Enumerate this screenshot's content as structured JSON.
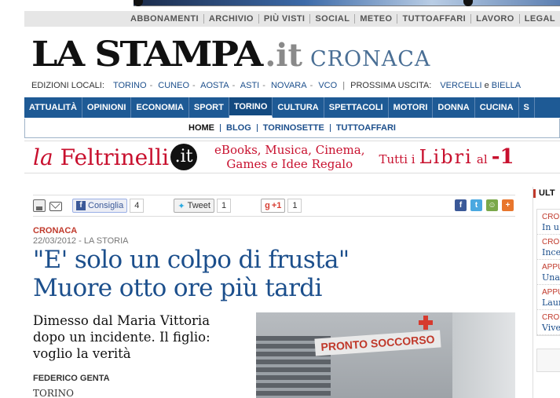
{
  "utility_nav": [
    "ABBONAMENTI",
    "ARCHIVIO",
    "PIÙ VISTI",
    "SOCIAL",
    "METEO",
    "TUTTOAFFARI",
    "LAVORO",
    "LEGAL"
  ],
  "masthead": {
    "logo": "LA STAMPA",
    "logo_suffix": ".it",
    "section": "CRONACA"
  },
  "editions": {
    "label": "EDIZIONI LOCALI:",
    "items": [
      "TORINO",
      "CUNEO",
      "AOSTA",
      "ASTI",
      "NOVARA",
      "VCO"
    ],
    "next_label": "PROSSIMA USCITA:",
    "next_items": [
      "VERCELLI",
      "BIELLA"
    ],
    "conj": "e"
  },
  "main_nav": [
    "ATTUALITÀ",
    "OPINIONI",
    "ECONOMIA",
    "SPORT",
    "TORINO",
    "CULTURA",
    "SPETTACOLI",
    "MOTORI",
    "DONNA",
    "CUCINA",
    "S"
  ],
  "main_nav_active": "TORINO",
  "sub_nav": [
    "HOME",
    "BLOG",
    "TORINOSETTE",
    "TUTTOAFFARI"
  ],
  "ad": {
    "brand_la": "la",
    "brand_name": "Feltrinelli",
    "brand_it": ".it",
    "tagline_1": "eBooks, Musica, Cinema,",
    "tagline_2": "Games e Idee Regalo",
    "promo_1": "Tutti i",
    "promo_2": "Libri",
    "promo_3": "al",
    "promo_4": "-1"
  },
  "share": {
    "fb_label": "Consiglia",
    "fb_count": "4",
    "tw_label": "Tweet",
    "tw_count": "1",
    "gp_label": "+1",
    "gp_count": "1"
  },
  "article": {
    "kicker": "CRONACA",
    "dateline": "22/03/2012 - LA STORIA",
    "headline_1": "\"E' solo un colpo di frusta\"",
    "headline_2": "Muore otto ore più tardi",
    "subhead": "Dimesso dal Maria Vittoria dopo un incidente. Il figlio: voglio la verità",
    "author": "FEDERICO GENTA",
    "place": "TORINO",
    "photo_sign": "PRONTO SOCCORSO"
  },
  "sidebar": {
    "title": "ULT",
    "items": [
      {
        "cat": "CRON",
        "title": "In u"
      },
      {
        "cat": "CRON",
        "title": "Ince"
      },
      {
        "cat": "APPU",
        "title": "Una"
      },
      {
        "cat": "APPU",
        "title": "Laur"
      },
      {
        "cat": "CRON",
        "title": "Vive"
      }
    ]
  },
  "colors": {
    "brand_blue": "#1e5a95",
    "link_blue": "#1c4f8c",
    "accent_red": "#c0392b",
    "feltrinelli_red": "#c8102e"
  }
}
